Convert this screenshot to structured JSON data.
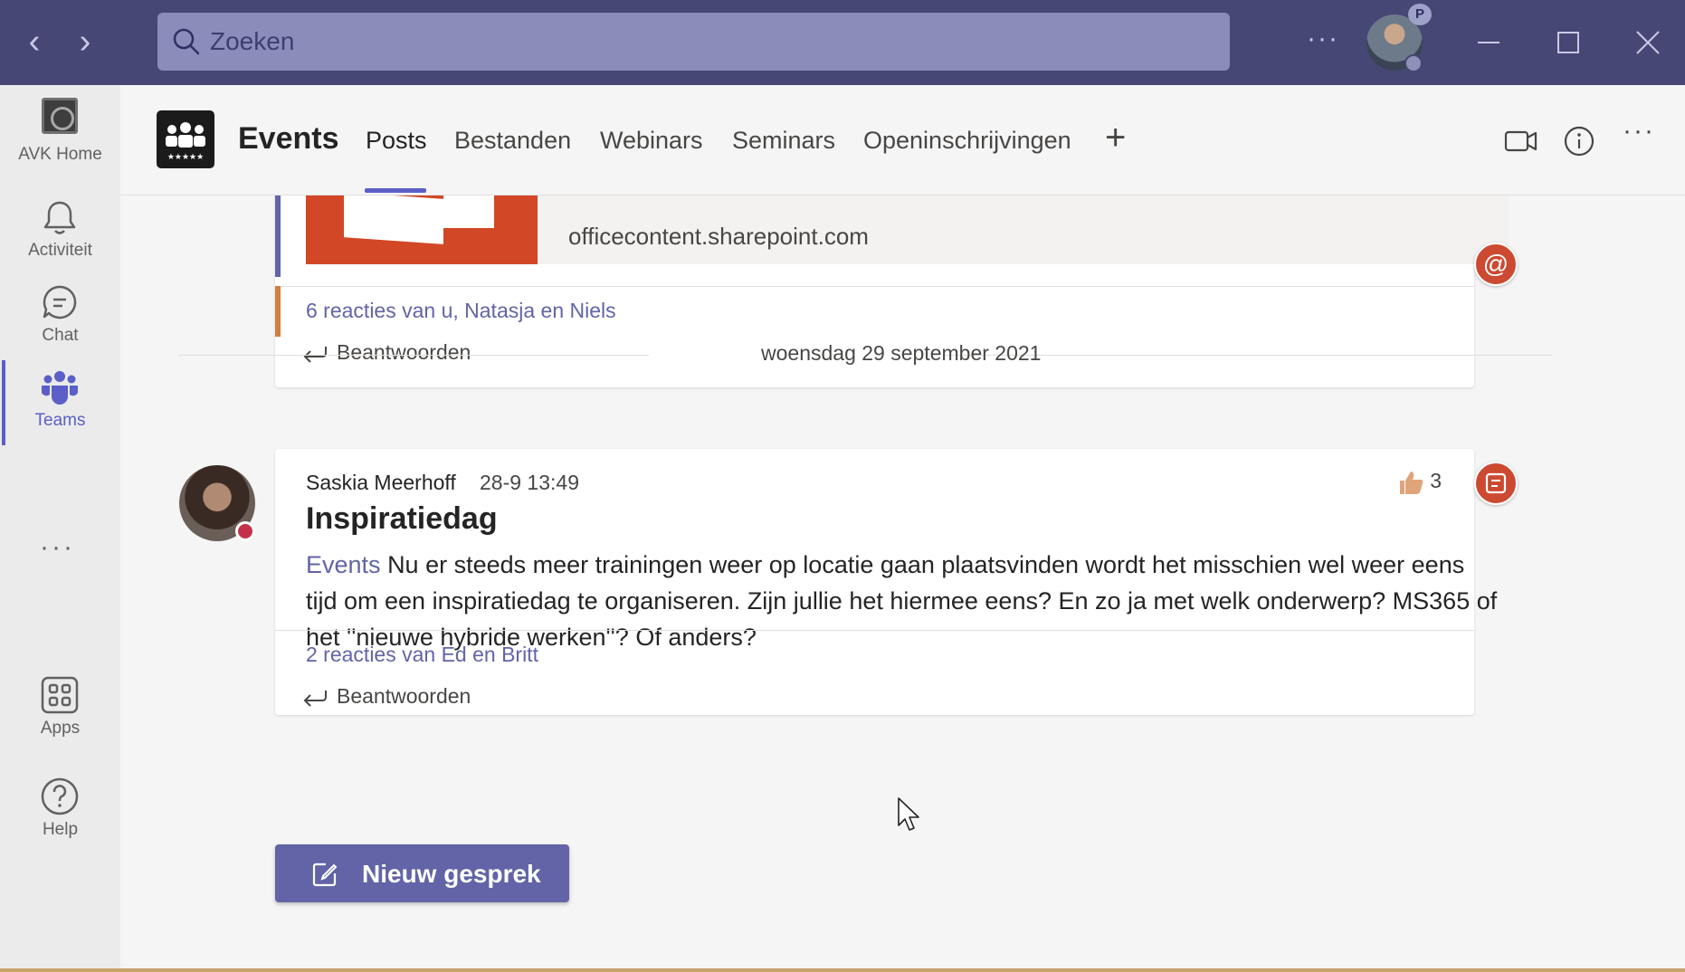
{
  "titlebar": {
    "search_placeholder": "Zoeken",
    "more": "···",
    "avatar_badge": "P"
  },
  "rail": {
    "items": [
      {
        "label": "AVK Home",
        "icon": "avk-home-logo"
      },
      {
        "label": "Activiteit",
        "icon": "bell-icon"
      },
      {
        "label": "Chat",
        "icon": "chat-icon"
      },
      {
        "label": "Teams",
        "icon": "teams-icon",
        "active": true
      },
      {
        "label": "Apps",
        "icon": "apps-icon"
      },
      {
        "label": "Help",
        "icon": "help-icon"
      }
    ],
    "more": "···"
  },
  "header": {
    "team_name": "Events",
    "tabs": [
      {
        "label": "Posts",
        "active": true
      },
      {
        "label": "Bestanden"
      },
      {
        "label": "Webinars"
      },
      {
        "label": "Seminars"
      },
      {
        "label": "Openinschrijvingen"
      }
    ],
    "add_tab": "+",
    "more": "···"
  },
  "posts": {
    "first": {
      "preview_domain": "officecontent.sharepoint.com",
      "reply_summary": "6 reacties van u, Natasja en Niels",
      "reply_label": "Beantwoorden",
      "badge": "@"
    },
    "date_separator": "woensdag 29 september 2021",
    "second": {
      "author": "Saskia Meerhoff",
      "time": "28-9 13:49",
      "subject": "Inspiratiedag",
      "mention": "Events",
      "body": "Nu er steeds meer trainingen weer op locatie gaan plaatsvinden wordt het misschien wel weer eens tijd om een inspiratiedag te organiseren. Zijn jullie het hiermee eens? En zo ja met welk onderwerp? MS365 of het ''nieuwe hybride werken''? Of anders?",
      "like_count": "3",
      "reply_summary": "2 reacties van Ed en Britt",
      "reply_label": "Beantwoorden"
    },
    "new_conversation": "Nieuw gesprek"
  },
  "colors": {
    "titlebar": "#464775",
    "accent": "#6264a7",
    "badge_red": "#cc4a31",
    "preview_orange": "#d24726"
  }
}
